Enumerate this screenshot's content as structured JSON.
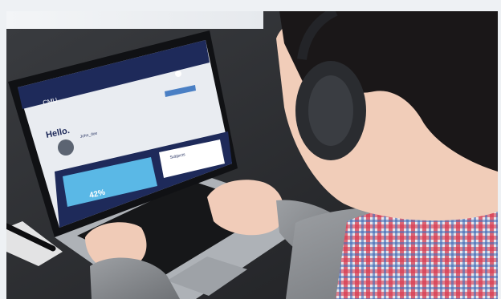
{
  "screen": {
    "logo_text": "CMU",
    "greeting": "Hello.",
    "user_name": "John_doe",
    "progress_percent_text": "42%",
    "progress_value": 0.42,
    "panel_title": "Subjects"
  },
  "colors": {
    "navy": "#1e2a5a",
    "light_blue": "#5ab8e6",
    "page_bg": "#e9ecf1"
  }
}
